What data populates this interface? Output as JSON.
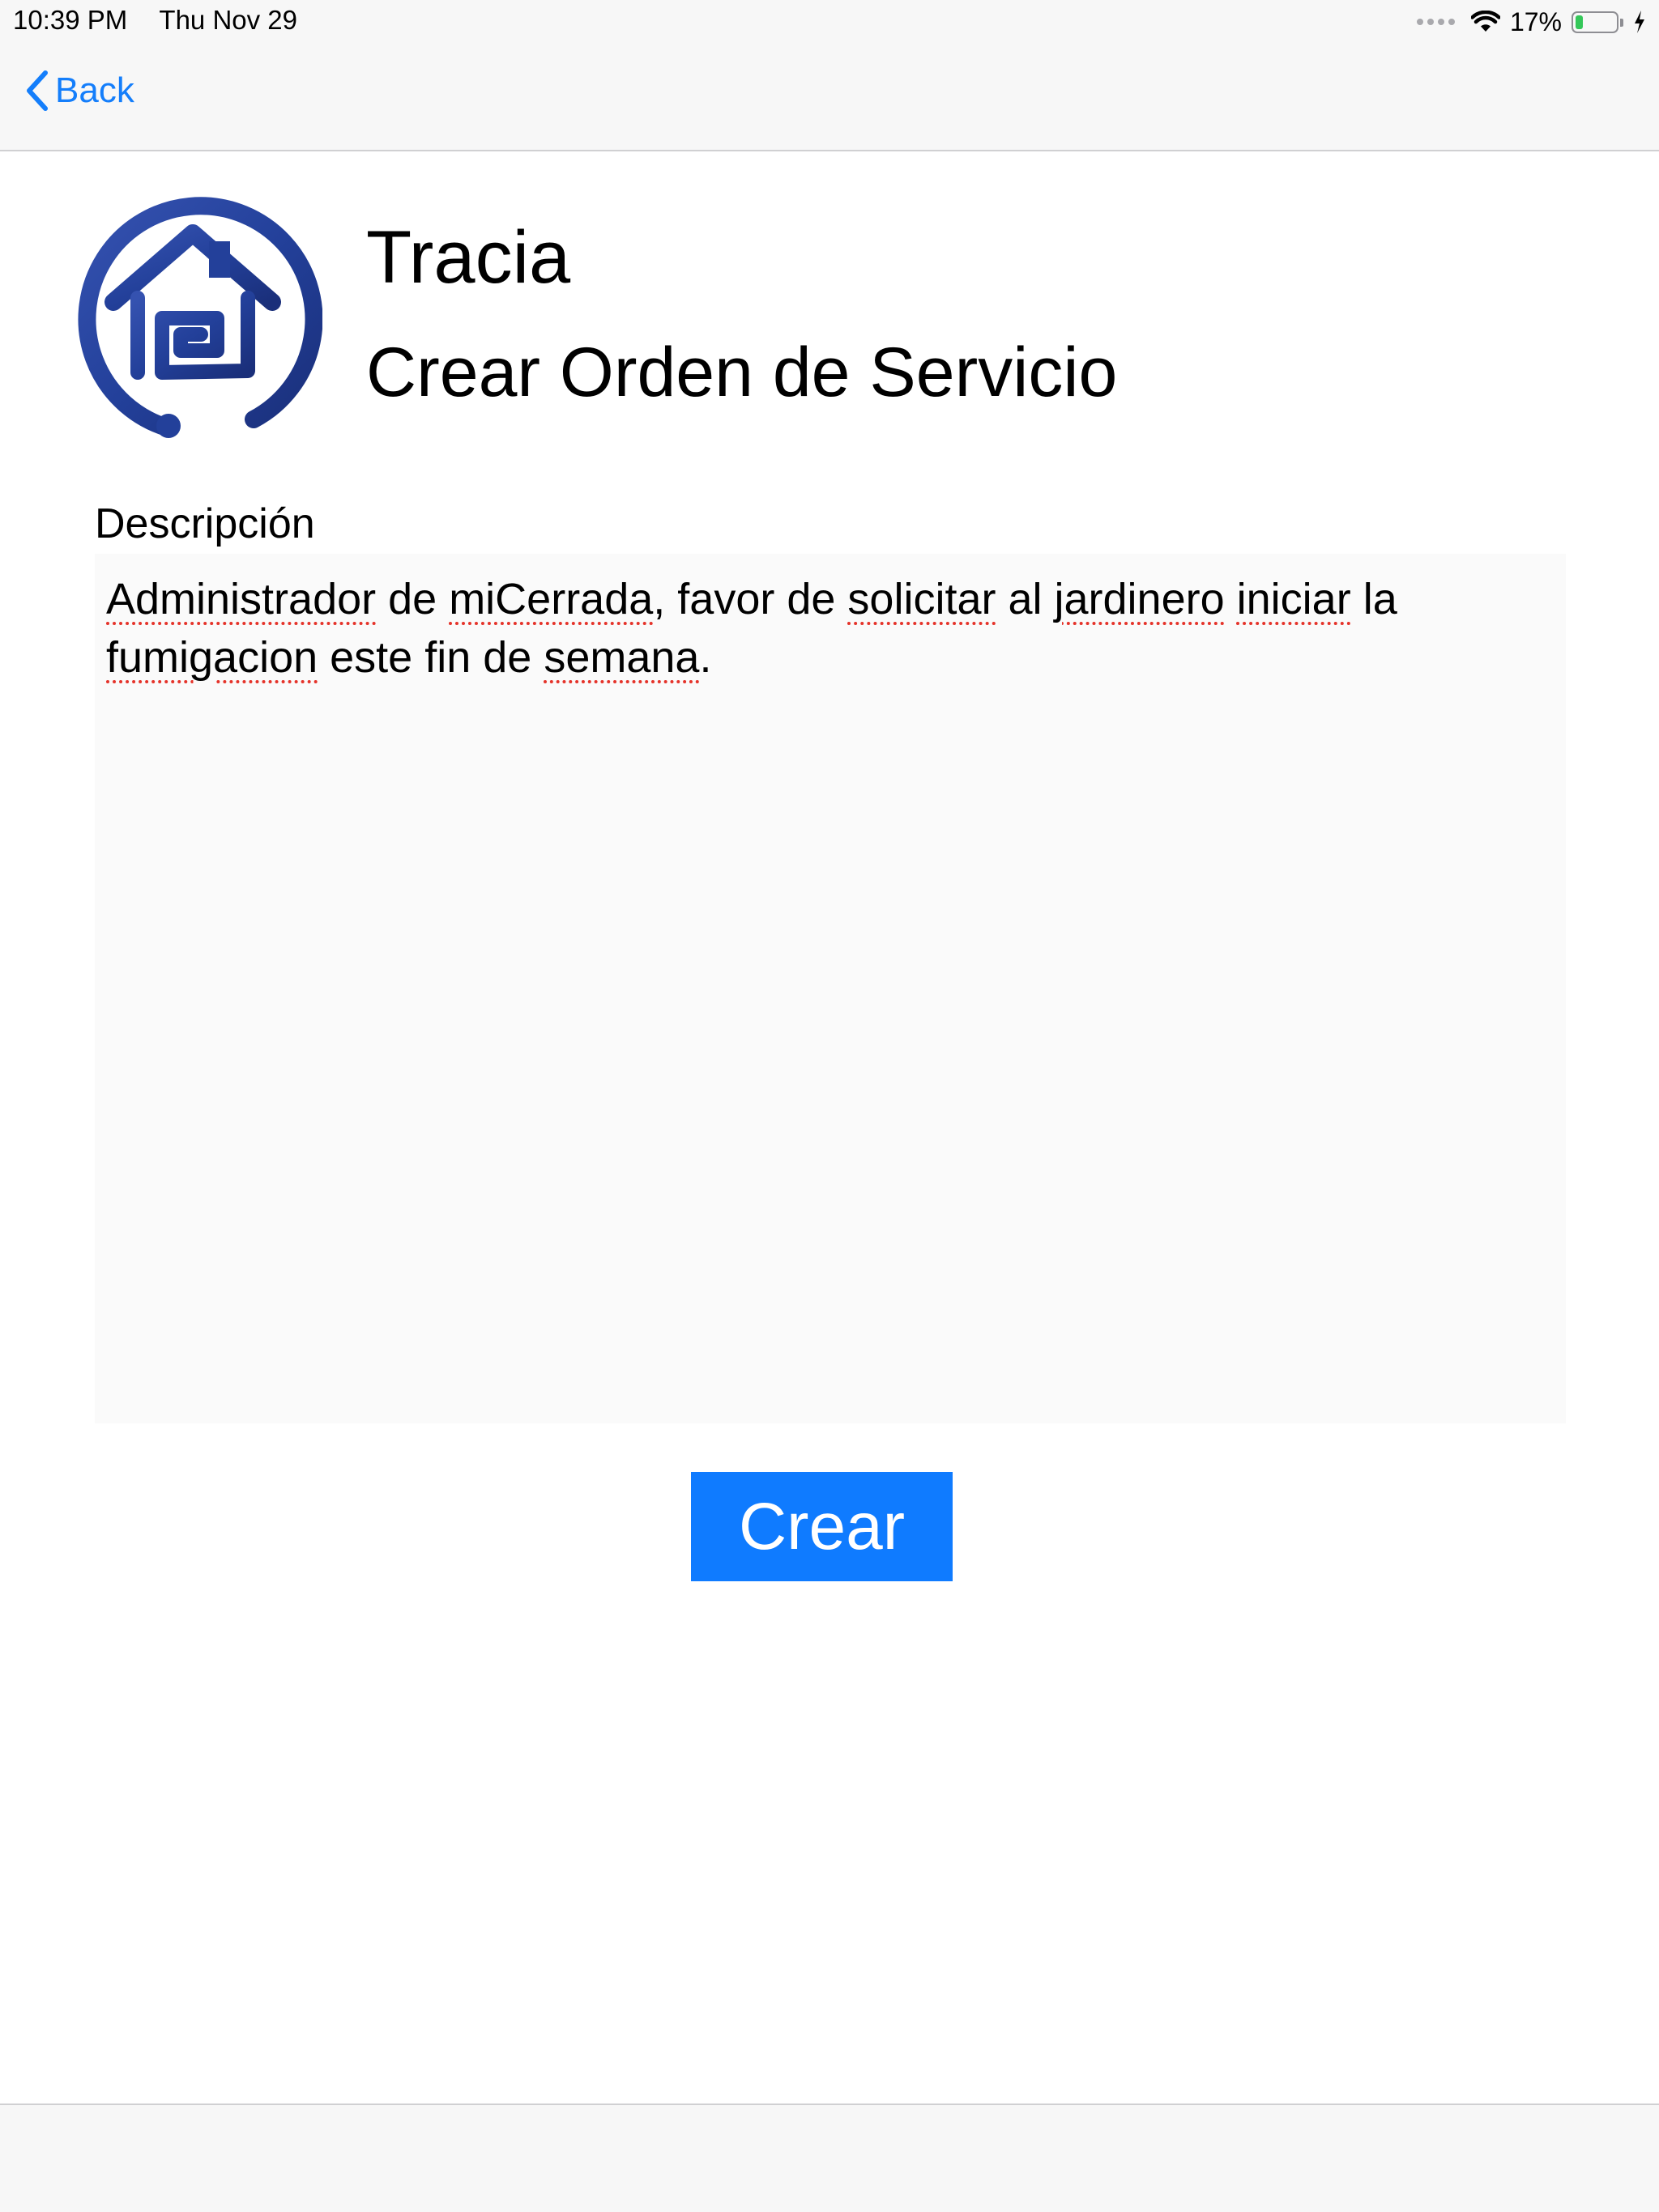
{
  "status_bar": {
    "time": "10:39 PM",
    "date": "Thu Nov 29",
    "battery_percent": "17%",
    "battery_level": 0.17,
    "charging": true
  },
  "nav": {
    "back_label": "Back"
  },
  "header": {
    "app_name": "Tracia",
    "page_title": "Crear Orden de Servicio"
  },
  "form": {
    "description_label": "Descripción",
    "description_words": [
      {
        "text": "Administrador",
        "misspelled": true
      },
      {
        "text": " de ",
        "misspelled": false
      },
      {
        "text": "miCerrada",
        "misspelled": true
      },
      {
        "text": ", favor de ",
        "misspelled": false
      },
      {
        "text": "solicitar",
        "misspelled": true
      },
      {
        "text": " al ",
        "misspelled": false
      },
      {
        "text": "jardinero",
        "misspelled": true
      },
      {
        "text": " ",
        "misspelled": false
      },
      {
        "text": "iniciar",
        "misspelled": true
      },
      {
        "text": " la ",
        "misspelled": false
      },
      {
        "text": "fumigacion",
        "misspelled": true
      },
      {
        "text": " este fin de ",
        "misspelled": false
      },
      {
        "text": "semana",
        "misspelled": true
      },
      {
        "text": ".",
        "misspelled": false
      }
    ],
    "submit_label": "Crear"
  },
  "colors": {
    "accent": "#147efb",
    "button": "#0f7bff",
    "logo_blue": "#23409a",
    "spell_underline": "#e5332a"
  },
  "icons": {
    "back": "chevron-left-icon",
    "wifi": "wifi-icon",
    "battery": "battery-icon",
    "charging": "bolt-icon",
    "logo": "house-logo-icon"
  }
}
